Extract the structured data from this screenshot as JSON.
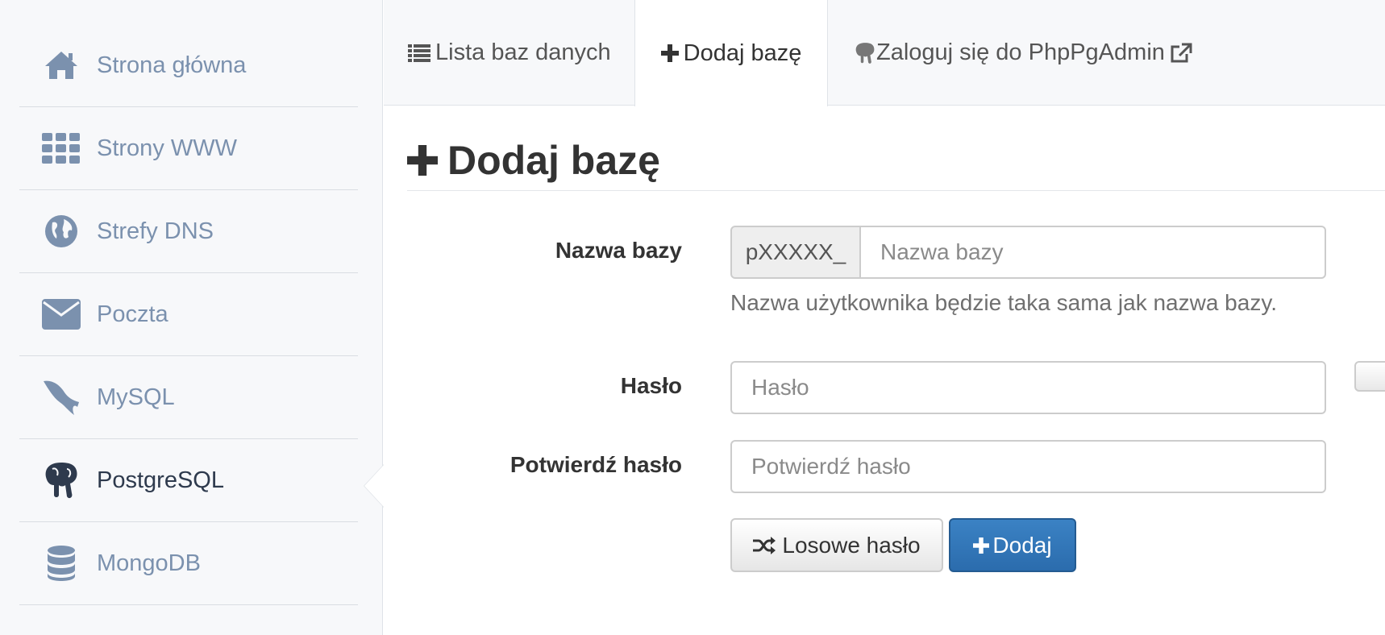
{
  "sidebar": {
    "items": [
      {
        "label": "Strona główna",
        "icon": "home-icon"
      },
      {
        "label": "Strony WWW",
        "icon": "grid-icon"
      },
      {
        "label": "Strefy DNS",
        "icon": "globe-icon"
      },
      {
        "label": "Poczta",
        "icon": "envelope-icon"
      },
      {
        "label": "MySQL",
        "icon": "dolphin-icon"
      },
      {
        "label": "PostgreSQL",
        "icon": "elephant-icon",
        "active": true
      },
      {
        "label": "MongoDB",
        "icon": "database-icon"
      }
    ]
  },
  "tabs": [
    {
      "label": "Lista baz danych",
      "icon": "list-icon"
    },
    {
      "label": "Dodaj bazę",
      "icon": "plus-icon",
      "active": true
    },
    {
      "label": "Zaloguj się do PhpPgAdmin",
      "icon": "elephant-icon",
      "trailing_icon": "external-link-icon"
    }
  ],
  "page": {
    "title": "Dodaj bazę"
  },
  "form": {
    "db_name_label": "Nazwa bazy",
    "db_name_prefix": "pXXXXX_",
    "db_name_placeholder": "Nazwa bazy",
    "db_name_value": "",
    "db_name_help": "Nazwa użytkownika będzie taka sama jak nazwa bazy.",
    "password_label": "Hasło",
    "password_placeholder": "Hasło",
    "password_value": "",
    "confirm_label": "Potwierdź hasło",
    "confirm_placeholder": "Potwierdź hasło",
    "confirm_value": "",
    "random_button": "Losowe hasło",
    "submit_button": "Dodaj"
  },
  "colors": {
    "sidebar_bg": "#f7f8fa",
    "sidebar_text": "#7b91ae",
    "sidebar_active_text": "#2e3a4d",
    "primary": "#2b6cad"
  }
}
